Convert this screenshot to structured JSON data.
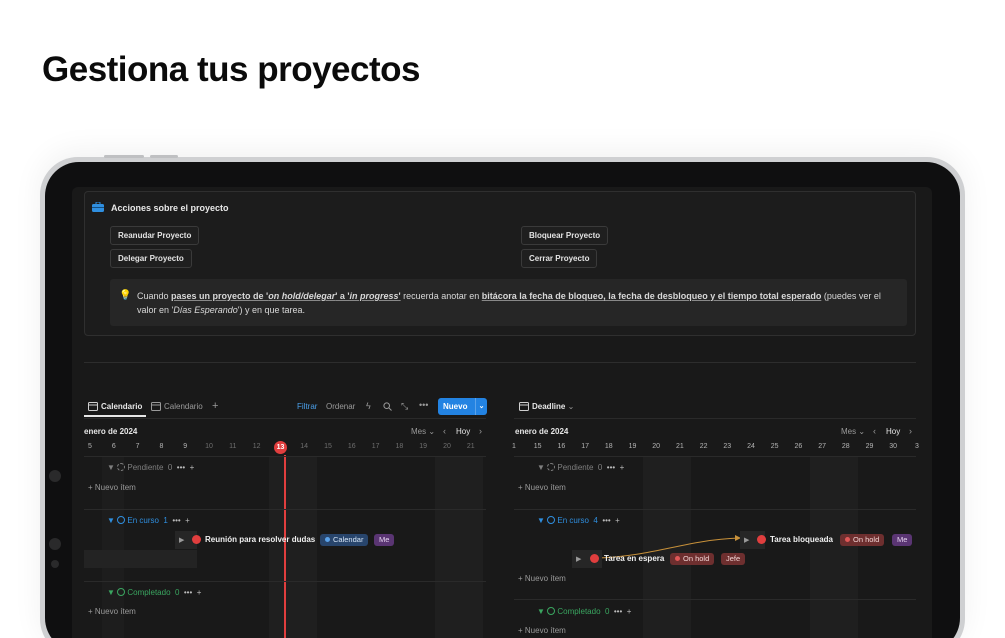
{
  "headline": "Gestiona tus proyectos",
  "callout": {
    "title": "Acciones sobre el proyecto",
    "buttons": {
      "resume": "Reanudar Proyecto",
      "delegate": "Delegar Proyecto",
      "block": "Bloquear Proyecto",
      "close": "Cerrar Proyecto"
    },
    "tip": {
      "p1": "Cuando ",
      "p2": "pases un proyecto de '",
      "p3": "on hold/delegar",
      "p4": "' a '",
      "p5": "in progress",
      "p6": "'",
      "p7": " recuerda anotar en ",
      "p8": "bitácora la fecha de bloqueo, la fecha de desbloqueo y el tiempo total esperado",
      "p9": " (puedes ver el valor en '",
      "p10": "Días Esperando",
      "p11": "') y en que tarea."
    }
  },
  "left_view": {
    "tab_active": "Calendario",
    "tab_other": "Calendario",
    "filter": "Filtrar",
    "sort": "Ordenar",
    "new_label": "Nuevo",
    "month": "enero de 2024",
    "range": "Mes",
    "today": "Hoy",
    "days": [
      "5",
      "6",
      "7",
      "8",
      "9",
      "10",
      "11",
      "12",
      "13",
      "14",
      "15",
      "16",
      "17",
      "18",
      "19",
      "20",
      "21"
    ],
    "today_day": "13",
    "groups": {
      "pending": {
        "label": "Pendiente",
        "count": "0"
      },
      "in_progress": {
        "label": "En curso",
        "count": "1"
      },
      "done": {
        "label": "Completado",
        "count": "0"
      }
    },
    "new_item": "Nuevo ítem",
    "task": {
      "title": "Reunión para resolver dudas",
      "tag1": "Calendar",
      "tag2": "Me"
    }
  },
  "right_view": {
    "tab": "Deadline",
    "month": "enero de 2024",
    "range": "Mes",
    "today": "Hoy",
    "days": [
      "1",
      "15",
      "16",
      "17",
      "18",
      "19",
      "20",
      "21",
      "22",
      "23",
      "24",
      "25",
      "26",
      "27",
      "28",
      "29",
      "30",
      "3"
    ],
    "groups": {
      "pending": {
        "label": "Pendiente",
        "count": "0"
      },
      "in_progress": {
        "label": "En curso",
        "count": "4"
      },
      "done": {
        "label": "Completado",
        "count": "0"
      }
    },
    "new_item": "Nuevo ítem",
    "task_blocked": {
      "title": "Tarea bloqueada",
      "tag1": "On hold",
      "tag2": "Me"
    },
    "task_waiting": {
      "title": "Tarea en espera",
      "tag1": "On hold",
      "tag2": "Jefe"
    }
  }
}
